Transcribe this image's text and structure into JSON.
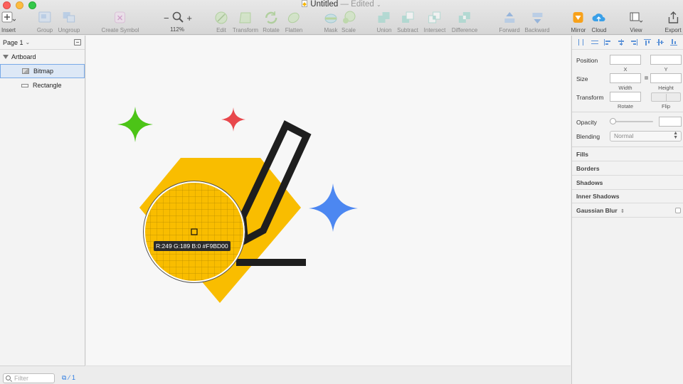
{
  "window": {
    "title": "Untitled",
    "edited": "— Edited"
  },
  "toolbar": {
    "insert": "Insert",
    "group": "Group",
    "ungroup": "Ungroup",
    "create_symbol": "Create Symbol",
    "zoom_minus": "−",
    "zoom_plus": "+",
    "zoom_value": "112%",
    "edit": "Edit",
    "transform": "Transform",
    "rotate": "Rotate",
    "flatten": "Flatten",
    "mask": "Mask",
    "scale": "Scale",
    "union": "Union",
    "subtract": "Subtract",
    "intersect": "Intersect",
    "difference": "Difference",
    "forward": "Forward",
    "backward": "Backward",
    "mirror": "Mirror",
    "cloud": "Cloud",
    "view": "View",
    "export": "Export"
  },
  "layers": {
    "page": "Page 1",
    "artboard": "Artboard",
    "items": [
      {
        "label": "Bitmap",
        "icon": "bitmap-icon",
        "selected": true
      },
      {
        "label": "Rectangle",
        "icon": "rectangle-icon",
        "selected": false
      }
    ],
    "filter_placeholder": "Filter",
    "count": "1"
  },
  "canvas": {
    "color_readout": "R:249 G:189 B:0 #F9BD00",
    "colors": {
      "yellow": "#f9bd00",
      "green": "#4cc417",
      "red": "#e8474c",
      "blue": "#4c87f1",
      "ink": "#1e1e1e"
    }
  },
  "inspector": {
    "position": "Position",
    "x": "X",
    "y": "Y",
    "size": "Size",
    "width": "Width",
    "height": "Height",
    "transform": "Transform",
    "rotate": "Rotate",
    "flip": "Flip",
    "opacity": "Opacity",
    "blending": "Blending",
    "blending_value": "Normal",
    "fills": "Fills",
    "borders": "Borders",
    "shadows": "Shadows",
    "inner_shadows": "Inner Shadows",
    "gaussian_blur": "Gaussian Blur"
  }
}
